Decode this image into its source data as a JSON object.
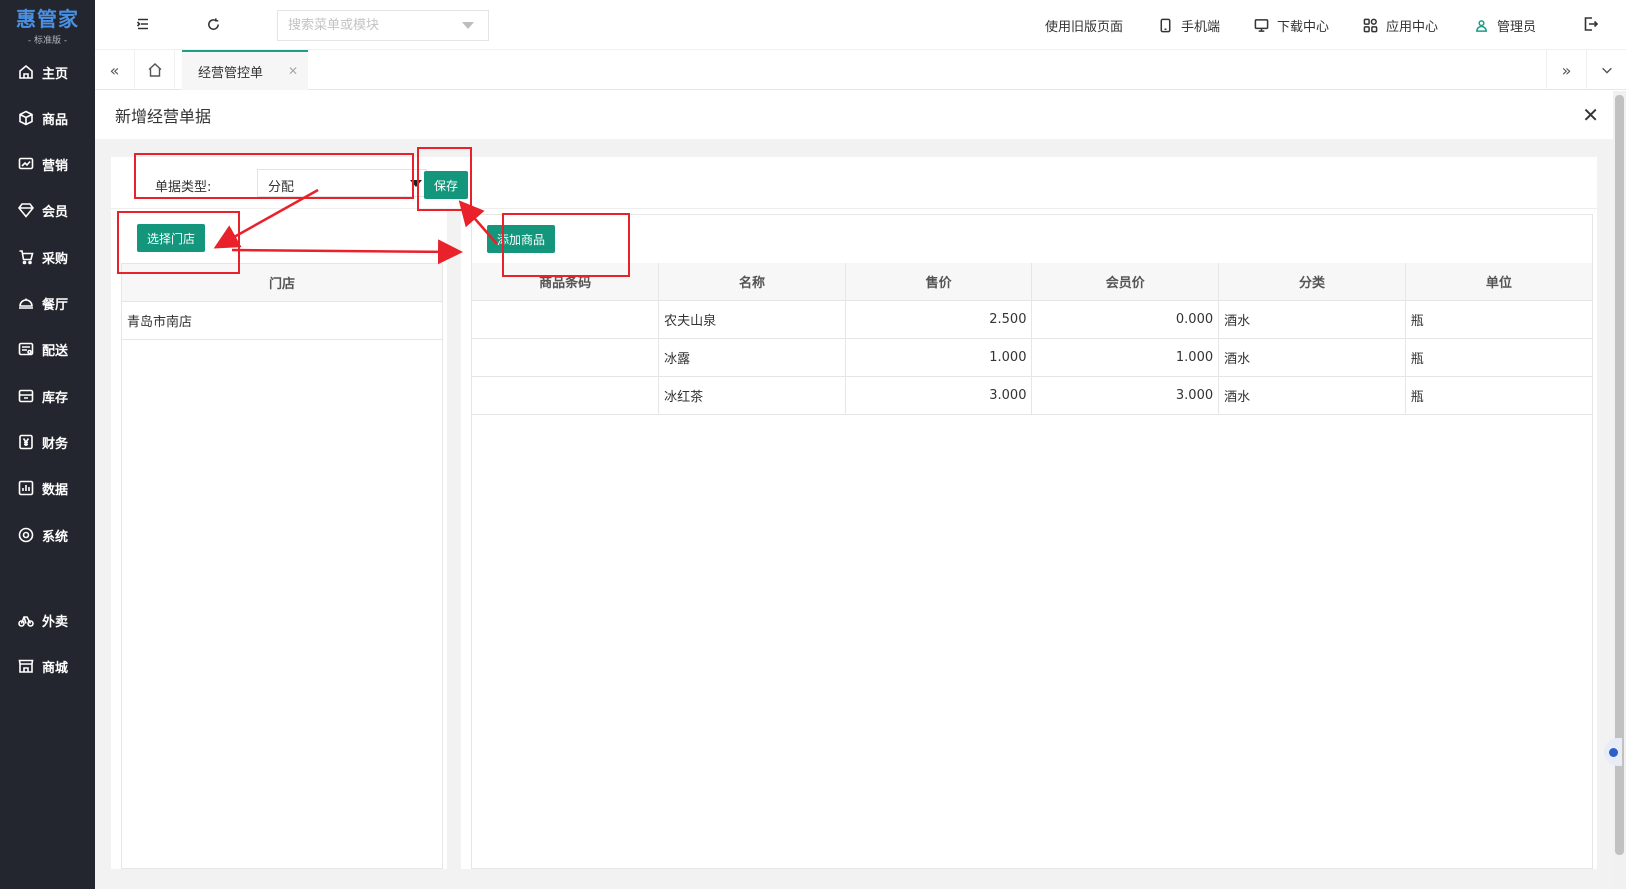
{
  "logo": {
    "main": "惠管家",
    "sub": "- 标准版 -"
  },
  "sidebar": {
    "items": [
      {
        "label": "主页",
        "icon": "home-icon"
      },
      {
        "label": "商品",
        "icon": "box-icon"
      },
      {
        "label": "营销",
        "icon": "chart-icon"
      },
      {
        "label": "会员",
        "icon": "diamond-icon"
      },
      {
        "label": "采购",
        "icon": "cart-icon"
      },
      {
        "label": "餐厅",
        "icon": "dish-icon"
      },
      {
        "label": "配送",
        "icon": "truck-icon"
      },
      {
        "label": "库存",
        "icon": "warehouse-icon"
      },
      {
        "label": "财务",
        "icon": "yen-icon"
      },
      {
        "label": "数据",
        "icon": "bar-chart-icon"
      },
      {
        "label": "系统",
        "icon": "settings-icon"
      },
      {
        "label": "外卖",
        "icon": "bike-icon"
      },
      {
        "label": "商城",
        "icon": "store-icon"
      }
    ]
  },
  "topbar": {
    "search_placeholder": "搜索菜单或模块",
    "links": {
      "old_page": "使用旧版页面",
      "mobile": "手机端",
      "download": "下载中心",
      "apps": "应用中心",
      "user": "管理员"
    }
  },
  "tabs": {
    "active": "经营管控单"
  },
  "panel": {
    "title": "新增经营单据"
  },
  "form": {
    "type_label": "单据类型:",
    "type_value": "分配",
    "save_label": "保存",
    "select_store_label": "选择门店",
    "add_product_label": "添加商品"
  },
  "store_table": {
    "header": "门店",
    "rows": [
      "青岛市南店"
    ]
  },
  "product_table": {
    "headers": [
      "商品条码",
      "名称",
      "售价",
      "会员价",
      "分类",
      "单位"
    ],
    "rows": [
      {
        "barcode": "",
        "name": "农夫山泉",
        "price": "2.500",
        "member_price": "0.000",
        "category": "酒水",
        "unit": "瓶"
      },
      {
        "barcode": "",
        "name": "冰露",
        "price": "1.000",
        "member_price": "1.000",
        "category": "酒水",
        "unit": "瓶"
      },
      {
        "barcode": "",
        "name": "冰红茶",
        "price": "3.000",
        "member_price": "3.000",
        "category": "酒水",
        "unit": "瓶"
      }
    ]
  },
  "colors": {
    "sidebar": "#23262e",
    "primary": "#14967c",
    "annotation": "#e8212b",
    "logo": "#4a90e2"
  }
}
